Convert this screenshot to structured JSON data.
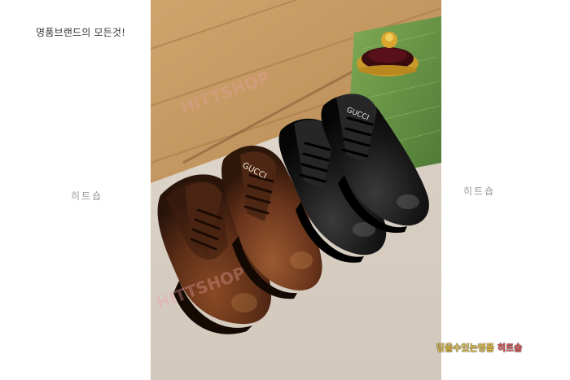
{
  "page": {
    "tagline": "명품브랜드의 모든것!",
    "left_mark": "히트숍",
    "right_mark": "히트숍",
    "caption_part1": "믿을수있는명품",
    "caption_part2": "히트숍"
  },
  "photo": {
    "watermark": "HITTSHOP",
    "shoe_brand": "GUCCI",
    "colors": {
      "wood_wall": "#c79a63",
      "floor": "#d8cfc3",
      "box_green": "#6e9a4a",
      "brown_shoe": "#5a2c18",
      "black_shoe": "#141414"
    }
  }
}
